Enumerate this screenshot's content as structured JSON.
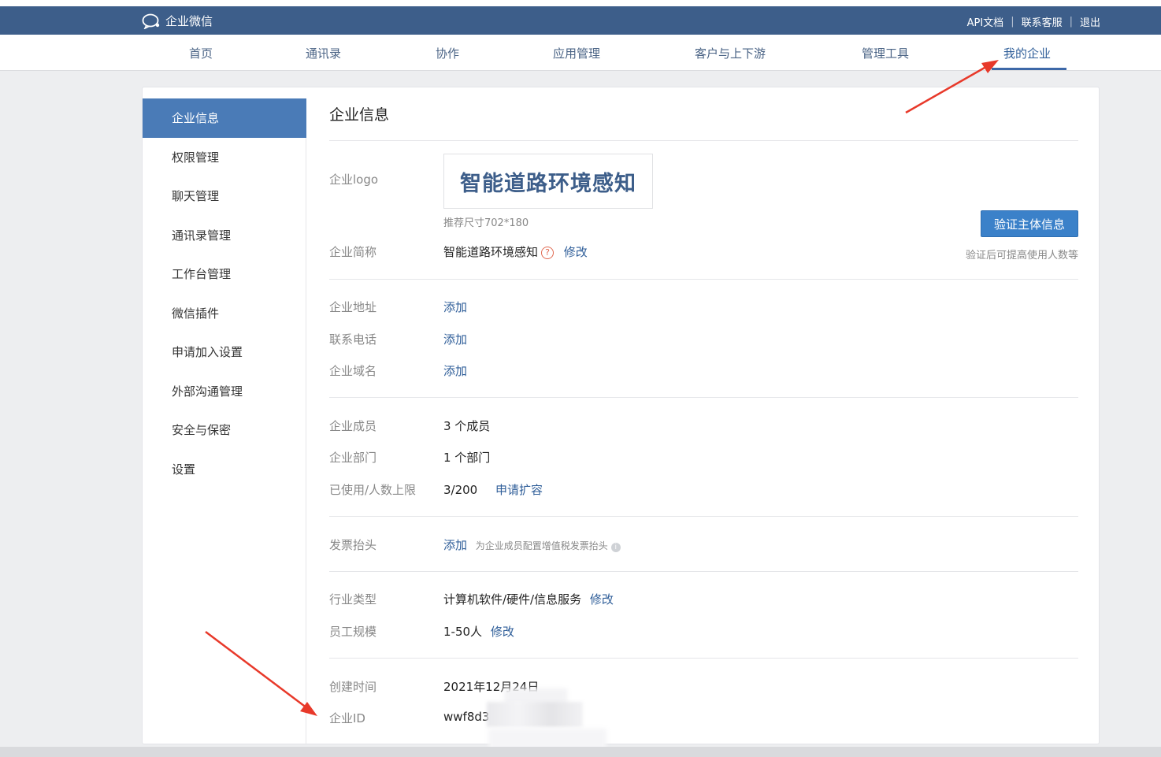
{
  "header": {
    "brand": "企业微信",
    "links": [
      "API文档",
      "联系客服",
      "退出"
    ],
    "brand_color": "#3d5e8a"
  },
  "nav": {
    "items": [
      "首页",
      "通讯录",
      "协作",
      "应用管理",
      "客户与上下游",
      "管理工具",
      "我的企业"
    ],
    "active": "我的企业"
  },
  "sidebar": {
    "items": [
      "企业信息",
      "权限管理",
      "聊天管理",
      "通讯录管理",
      "工作台管理",
      "微信插件",
      "申请加入设置",
      "外部沟通管理",
      "安全与保密",
      "设置"
    ],
    "active": "企业信息"
  },
  "main": {
    "title": "企业信息",
    "logo_label": "企业logo",
    "logo_text": "智能道路环境感知",
    "logo_hint": "推荐尺寸702*180",
    "verify_button": "验证主体信息",
    "verify_hint": "验证后可提高使用人数等",
    "short_name_label": "企业简称",
    "short_name": "智能道路环境感知",
    "help_icon": "?",
    "edit": "修改",
    "address_label": "企业地址",
    "phone_label": "联系电话",
    "domain_label": "企业域名",
    "add": "添加",
    "members_label": "企业成员",
    "members_value": "3 个成员",
    "depts_label": "企业部门",
    "depts_value": "1 个部门",
    "limit_label": "已使用/人数上限",
    "limit_value": "3/200",
    "expand_link": "申请扩容",
    "invoice_label": "发票抬头",
    "invoice_hint": "为企业成员配置增值税发票抬头",
    "info_icon": "i",
    "industry_label": "行业类型",
    "industry_value": "计算机软件/硬件/信息服务",
    "scale_label": "员工规模",
    "scale_value": "1-50人",
    "created_label": "创建时间",
    "created_value": "2021年12月24日",
    "corp_id_label": "企业ID",
    "corp_id_value": "wwf8d3"
  },
  "annotations": {
    "arrow_color": "#e8392a"
  }
}
